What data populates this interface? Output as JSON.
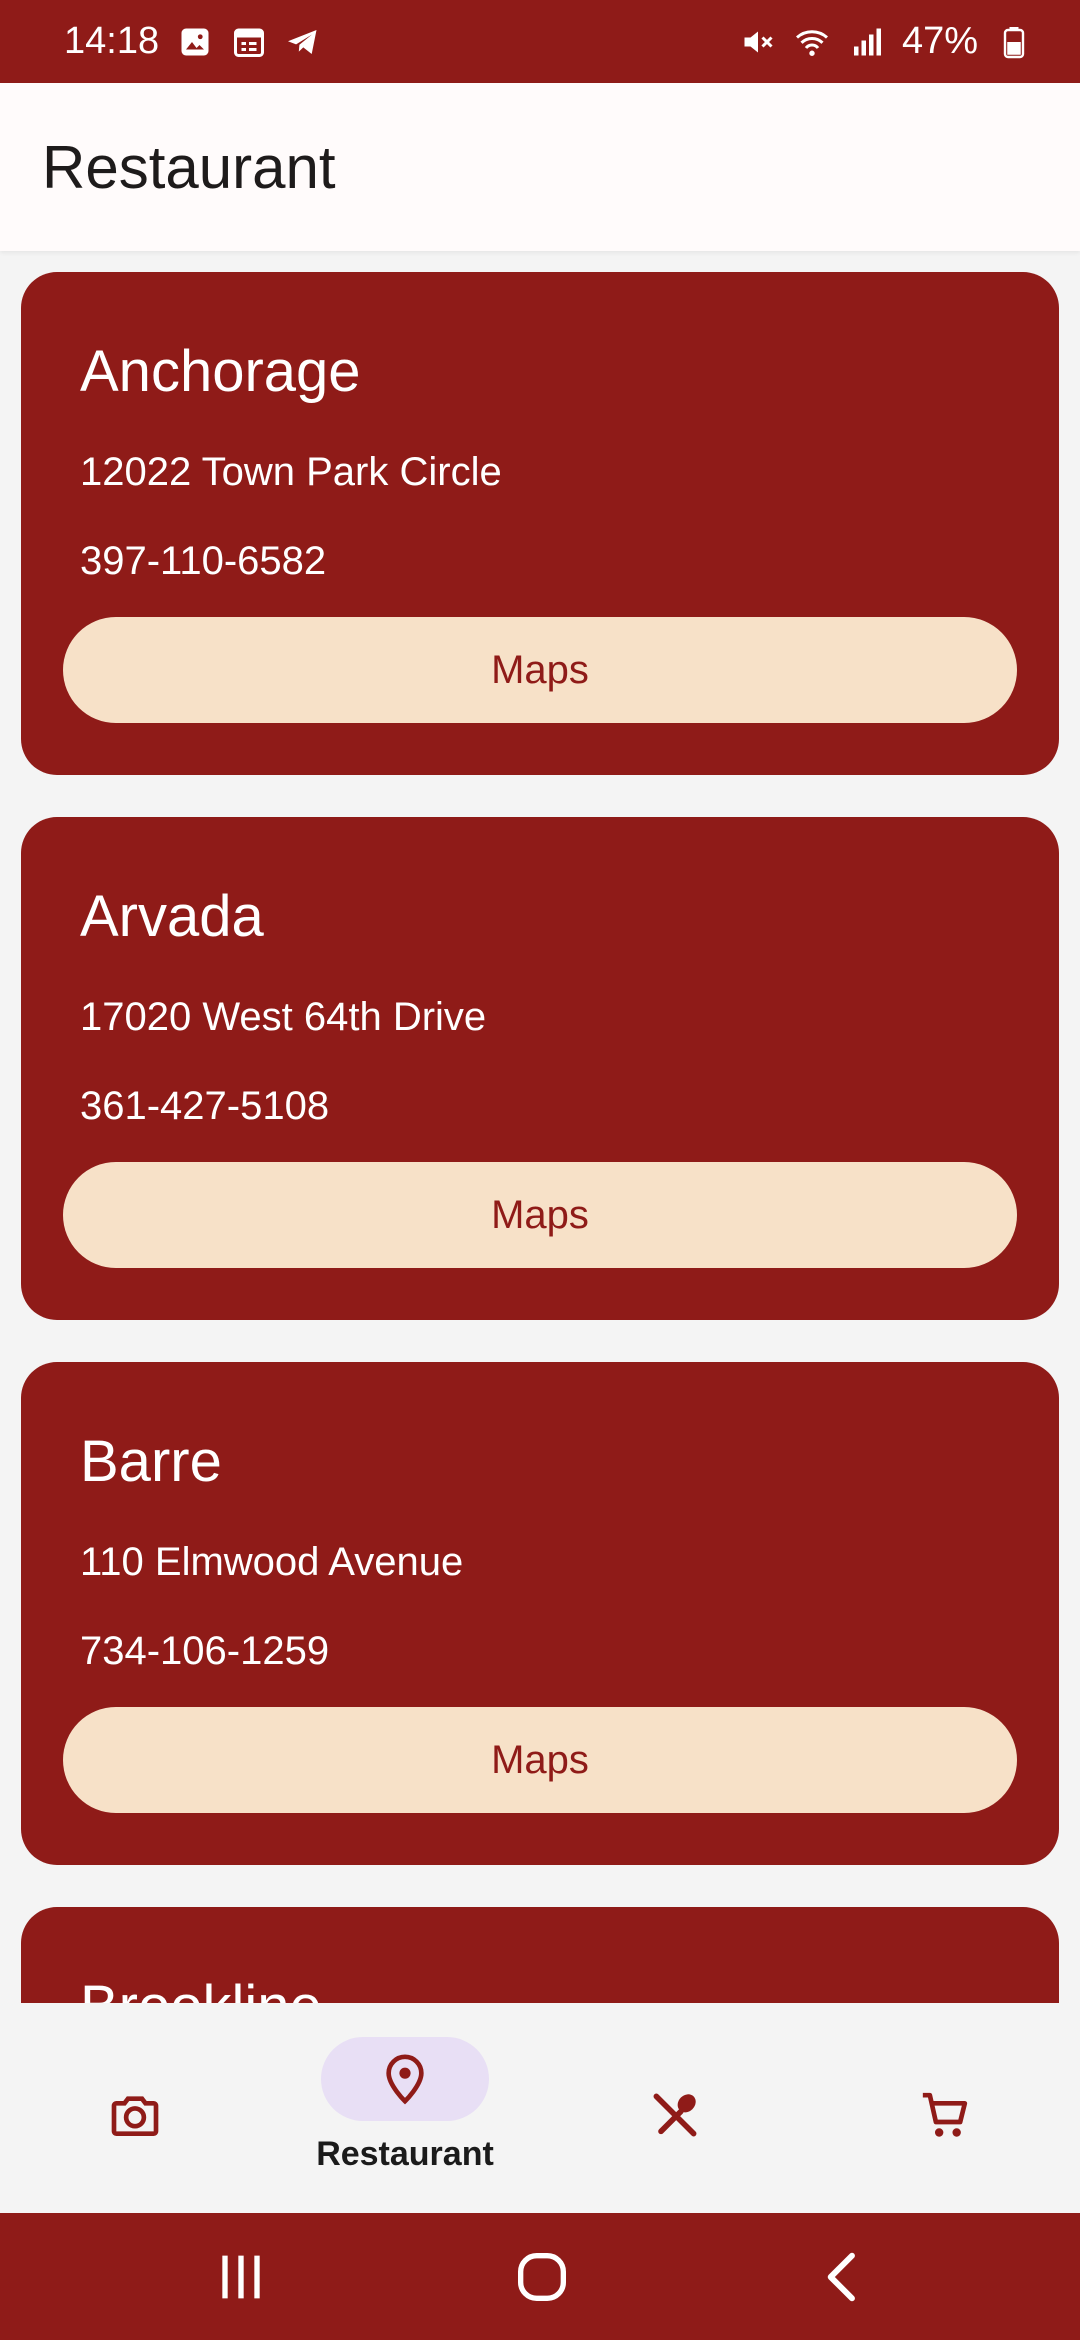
{
  "status_bar": {
    "time": "14:18",
    "battery": "47%",
    "left_icons": [
      "image-icon",
      "calendar-icon",
      "telegram-icon"
    ],
    "right_icons": [
      "mute-icon",
      "wifi-icon",
      "signal-icon",
      "battery-icon"
    ]
  },
  "app_bar": {
    "title": "Restaurant"
  },
  "restaurants": [
    {
      "city": "Anchorage",
      "address": "12022 Town Park Circle",
      "phone": "397-110-6582",
      "button": "Maps"
    },
    {
      "city": "Arvada",
      "address": "17020 West 64th Drive",
      "phone": "361-427-5108",
      "button": "Maps"
    },
    {
      "city": "Barre",
      "address": "110 Elmwood Avenue",
      "phone": "734-106-1259",
      "button": "Maps"
    },
    {
      "city": "Brookline"
    }
  ],
  "bottom_nav": {
    "items": [
      {
        "icon": "camera-icon"
      },
      {
        "icon": "location-pin-icon",
        "label": "Restaurant",
        "active": true
      },
      {
        "icon": "fork-spoon-icon"
      },
      {
        "icon": "cart-icon"
      }
    ]
  },
  "system_nav": [
    "recents-icon",
    "home-icon",
    "back-icon"
  ],
  "colors": {
    "primary": "#8f1b18",
    "button_bg": "#f7e1c8",
    "active_indicator": "#e8dff5",
    "background": "#f4f4f4"
  }
}
